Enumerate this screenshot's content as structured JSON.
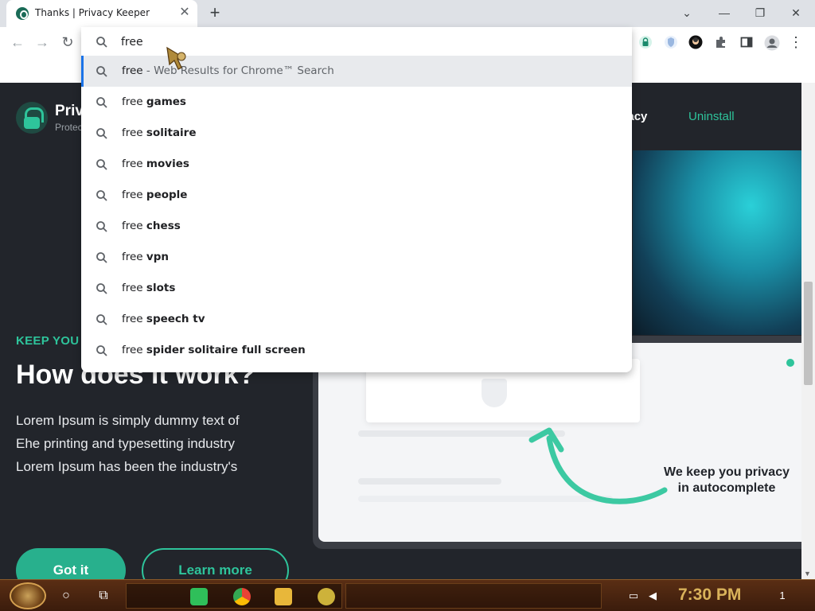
{
  "browser": {
    "tab_title": "Thanks | Privacy Keeper",
    "tab_close": "✕",
    "new_tab": "+",
    "back": "←",
    "forward": "→",
    "reload": "↻",
    "minimize": "⌄",
    "maximize_dash": "—",
    "restore": "❐",
    "close": "✕",
    "menu": "⋮"
  },
  "omnibox": {
    "value": "free",
    "suggestions": [
      {
        "prefix": "free",
        "bold": "",
        "extra": " - Web Results for Chrome™ Search"
      },
      {
        "prefix": "free ",
        "bold": "games",
        "extra": ""
      },
      {
        "prefix": "free ",
        "bold": "solitaire",
        "extra": ""
      },
      {
        "prefix": "free ",
        "bold": "movies",
        "extra": ""
      },
      {
        "prefix": "free ",
        "bold": "people",
        "extra": ""
      },
      {
        "prefix": "free ",
        "bold": "chess",
        "extra": ""
      },
      {
        "prefix": "free ",
        "bold": "vpn",
        "extra": ""
      },
      {
        "prefix": "free ",
        "bold": "slots",
        "extra": ""
      },
      {
        "prefix": "free ",
        "bold": "speech tv",
        "extra": ""
      },
      {
        "prefix": "free ",
        "bold": "spider solitaire full screen",
        "extra": ""
      }
    ]
  },
  "page": {
    "brand_name": "Priv",
    "brand_sub": "Protec",
    "nav_privacy": "rivacy",
    "nav_uninstall": "Uninstall",
    "kicker": "KEEP YOU",
    "headline": "How does it work?",
    "body_lines": [
      "Lorem Ipsum is simply dummy text of",
      "Ehe printing and typesetting industry",
      "Lorem Ipsum has been the industry's"
    ],
    "got_it": "Got it",
    "learn_more": "Learn more",
    "hero_caption_line1": "We keep you privacy",
    "hero_caption_line2": "in autocomplete",
    "accent_color": "#2ec49b"
  },
  "taskbar": {
    "clock": "7:30 PM",
    "search_icon": "○",
    "taskview_icon": "⧉",
    "notif_badge": "1"
  }
}
